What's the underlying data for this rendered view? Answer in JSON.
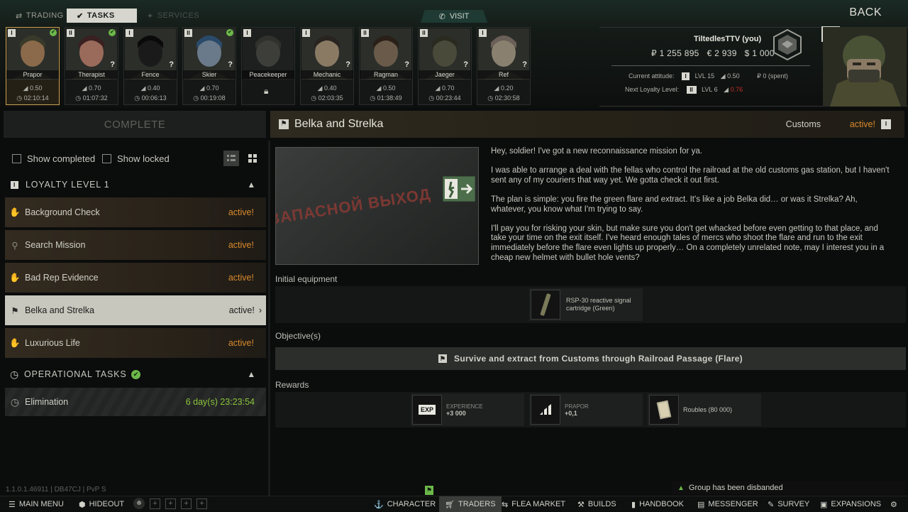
{
  "top_tabs": {
    "trading": "TRADING",
    "tasks": "TASKS",
    "services": "SERVICES"
  },
  "visit": "VISIT",
  "back": "BACK",
  "traders": [
    {
      "name": "Prapor",
      "level": "I",
      "rep": "0.50",
      "time": "02:10:14",
      "check": true,
      "question": false
    },
    {
      "name": "Therapist",
      "level": "II",
      "rep": "0.70",
      "time": "01:07:32",
      "check": true,
      "question": true
    },
    {
      "name": "Fence",
      "level": "I",
      "rep": "0.40",
      "time": "00:06:13",
      "check": false,
      "question": true
    },
    {
      "name": "Skier",
      "level": "II",
      "rep": "0.70",
      "time": "00:19:08",
      "check": true,
      "question": true
    },
    {
      "name": "Peacekeeper",
      "level": "I",
      "rep": "",
      "time": "",
      "check": false,
      "question": false,
      "locked": true
    },
    {
      "name": "Mechanic",
      "level": "I",
      "rep": "0.40",
      "time": "02:03:35",
      "check": false,
      "question": true
    },
    {
      "name": "Ragman",
      "level": "II",
      "rep": "0.50",
      "time": "01:38:49",
      "check": false,
      "question": true
    },
    {
      "name": "Jaeger",
      "level": "II",
      "rep": "0.70",
      "time": "00:23:44",
      "check": false,
      "question": true
    },
    {
      "name": "Ref",
      "level": "I",
      "rep": "0.20",
      "time": "02:30:58",
      "check": false,
      "question": true
    }
  ],
  "player": {
    "name": "TiltedlesTTV (you)",
    "roubles": "₽ 1 255 895",
    "euros": "€ 2 939",
    "dollars": "$ 1 000",
    "level_badge": "15",
    "current_attitude_label": "Current attitude:",
    "current_level_roman": "I",
    "current_lvl_text": "LVL 15",
    "current_rep": "0.50",
    "spent": "₽ 0 (spent)",
    "next_loyalty_label": "Next Loyalty Level:",
    "next_level_roman": "II",
    "next_lvl_text": "LVL 6",
    "next_rep": "0.76"
  },
  "left": {
    "complete": "COMPLETE",
    "show_completed": "Show completed",
    "show_locked": "Show locked",
    "loyalty_section": "LOYALTY LEVEL 1",
    "loyalty_badge": "I",
    "tasks": [
      {
        "name": "Background Check",
        "status": "active!"
      },
      {
        "name": "Search Mission",
        "status": "active!"
      },
      {
        "name": "Bad Rep Evidence",
        "status": "active!"
      },
      {
        "name": "Belka and Strelka",
        "status": "active!"
      },
      {
        "name": "Luxurious Life",
        "status": "active!"
      }
    ],
    "operational_section": "OPERATIONAL TASKS",
    "elimination": {
      "name": "Elimination",
      "time": "6 day(s) 23:23:54"
    }
  },
  "quest": {
    "title": "Belka and Strelka",
    "location": "Customs",
    "status": "active!",
    "status_badge": "I",
    "image_sign": "ЗАПАСНОЙ ВЫХОД",
    "description": [
      "Hey, soldier! I've got a new reconnaissance mission for ya.",
      "I was able to arrange a deal with the fellas who control the railroad at the old customs gas station, but I haven't sent any of my couriers that way yet. We gotta check it out first.",
      "The plan is simple: you fire the green flare and extract. It's like a job Belka did… or was it Strelka? Ah, whatever, you know what I'm trying to say.",
      "I'll pay you for risking your skin, but make sure you don't get whacked before even getting to that place, and take your time on the exit itself. I've heard enough tales of mercs who shoot the flare and run to the exit immediately before the flare even lights up properly… On a completely unrelated note, may I interest you in a cheap new helmet with bullet hole vents?"
    ],
    "initial_equipment_label": "Initial equipment",
    "equipment": "RSP-30 reactive signal cartridge (Green)",
    "objectives_label": "Objective(s)",
    "objective": "Survive and extract from Customs through Railroad Passage (Flare)",
    "rewards_label": "Rewards",
    "rewards": [
      {
        "badge": "EXP",
        "title": "EXPERIENCE",
        "value": "+3 000"
      },
      {
        "title": "PRAPOR",
        "value": "+0,1"
      },
      {
        "title": "Roubles (80 000)"
      }
    ]
  },
  "version": "1.1.0.1.46911 | DB47CJ | PvP S",
  "notice": "Group has been disbanded",
  "bottom_nav": {
    "main_menu": "MAIN MENU",
    "hideout": "HIDEOUT",
    "character": "CHARACTER",
    "traders": "TRADERS",
    "flea_market": "FLEA MARKET",
    "builds": "BUILDS",
    "handbook": "HANDBOOK",
    "messenger": "MESSENGER",
    "survey": "SURVEY",
    "expansions": "EXPANSIONS"
  },
  "colors": {
    "active_orange": "#d98a2c",
    "green_check": "#6cb84a",
    "timer_green": "#8ac43c",
    "next_rep_red": "#c0302a"
  }
}
